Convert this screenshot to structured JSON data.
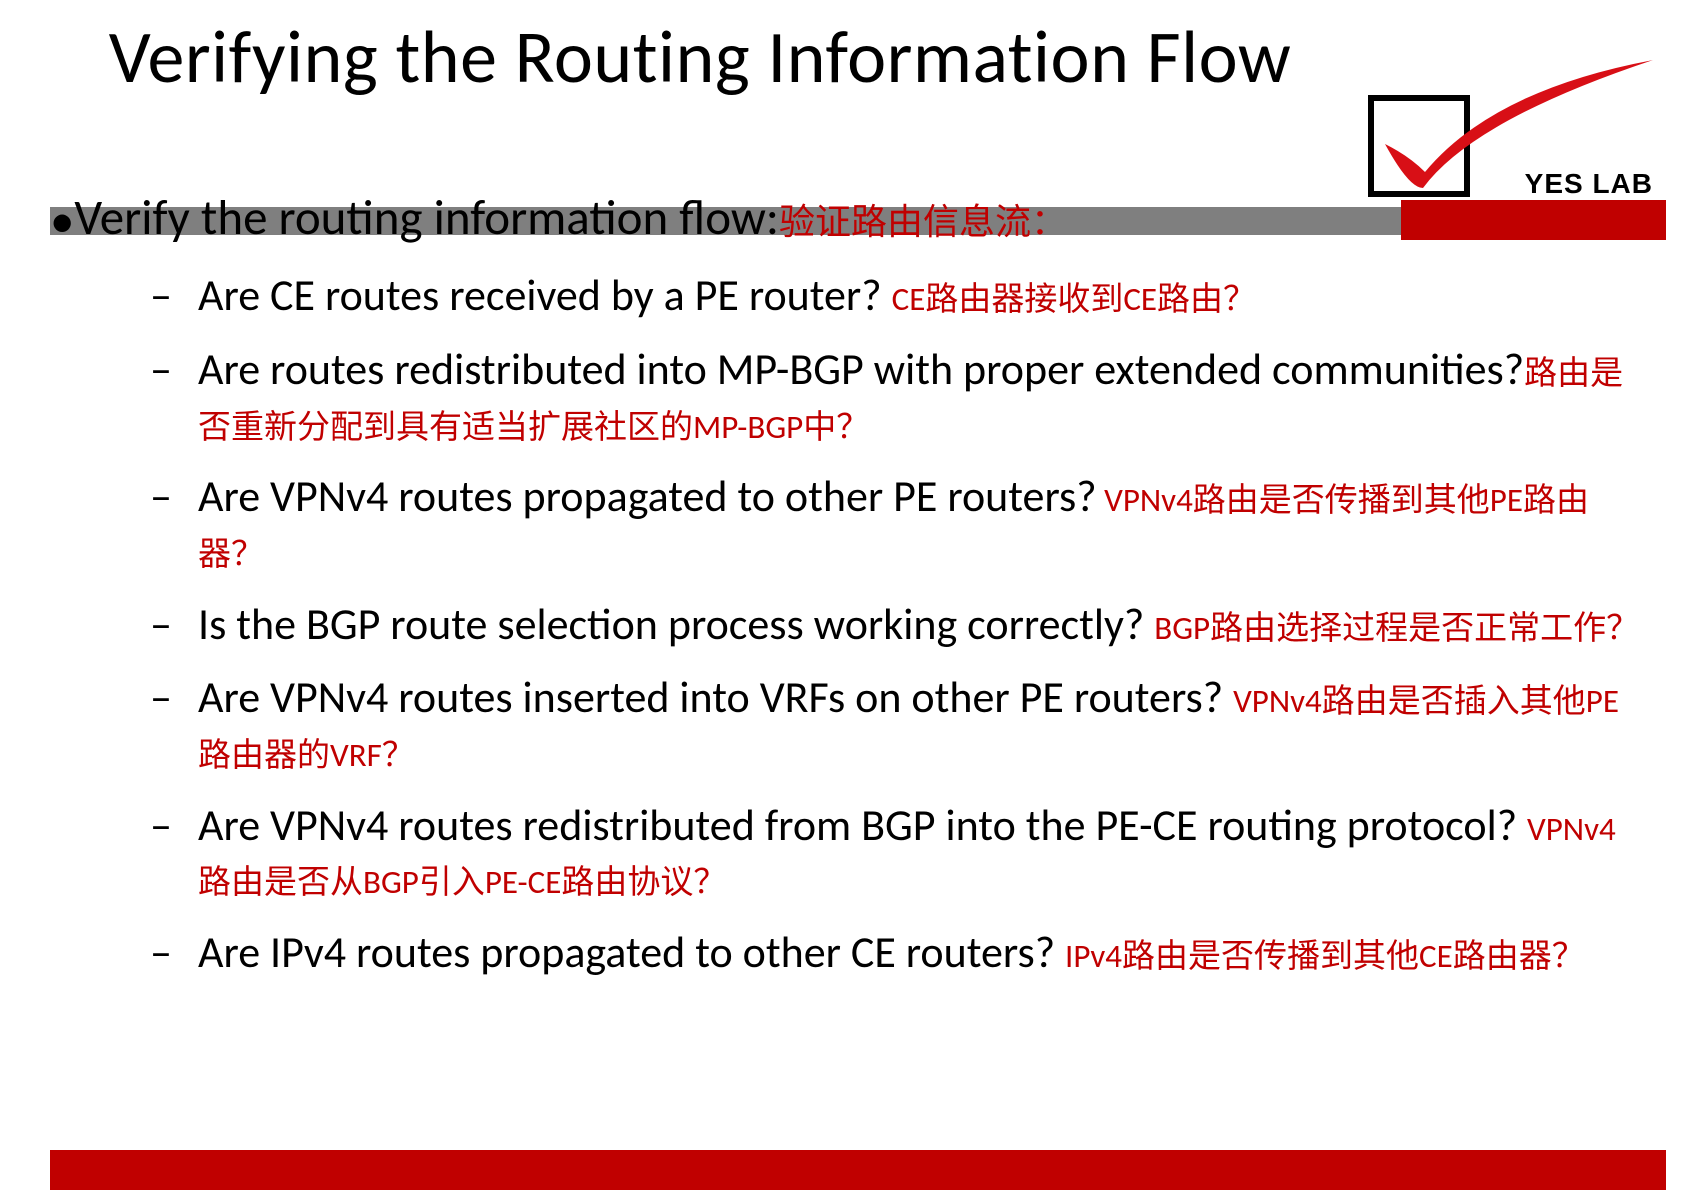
{
  "title": "Verifying the Routing Information Flow",
  "logo_text": "YES LAB",
  "colors": {
    "accent_red": "#c00000",
    "grey_bar": "#7f7f7f"
  },
  "top_bullet": {
    "en": "Verify the routing information flow:",
    "cn": "验证路由信息流："
  },
  "items": [
    {
      "en": "Are CE routes received by a PE router? ",
      "cn": "CE路由器接收到CE路由？"
    },
    {
      "en": "Are routes redistributed into MP-BGP with proper extended communities?",
      "cn": "路由是否重新分配到具有适当扩展社区的MP-BGP中？"
    },
    {
      "en": "Are VPNv4 routes propagated to other PE routers?",
      "cn": " VPNv4路由是否传播到其他PE路由器？"
    },
    {
      "en": "Is the BGP route selection process working correctly? ",
      "cn": "BGP路由选择过程是否正常工作？"
    },
    {
      "en": "Are VPNv4 routes inserted into VRFs on other PE  routers? ",
      "cn": "VPNv4路由是否插入其他PE路由器的VRF？"
    },
    {
      "en": "Are VPNv4 routes redistributed from BGP into the PE-CE routing protocol? ",
      "cn": "VPNv4路由是否从BGP引入PE-CE路由协议？"
    },
    {
      "en": "Are IPv4 routes propagated to other CE routers? ",
      "cn": "IPv4路由是否传播到其他CE路由器？"
    }
  ]
}
